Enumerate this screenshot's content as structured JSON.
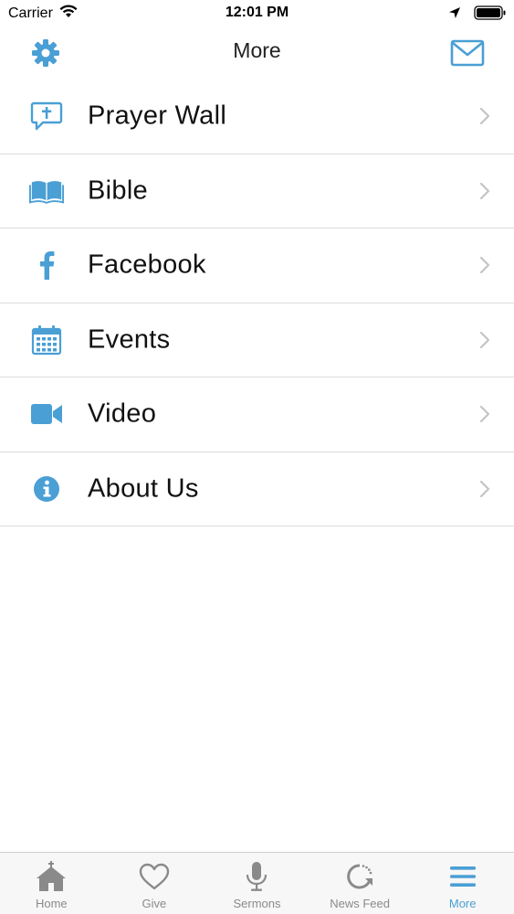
{
  "status_bar": {
    "carrier": "Carrier",
    "time": "12:01 PM"
  },
  "nav": {
    "title": "More",
    "left_icon": "gear-icon",
    "right_icon": "mail-icon"
  },
  "accent_color": "#4a9fd5",
  "menu": {
    "items": [
      {
        "label": "Prayer Wall",
        "icon": "prayer-wall-icon"
      },
      {
        "label": "Bible",
        "icon": "bible-icon"
      },
      {
        "label": "Facebook",
        "icon": "facebook-icon"
      },
      {
        "label": "Events",
        "icon": "calendar-icon"
      },
      {
        "label": "Video",
        "icon": "video-camera-icon"
      },
      {
        "label": "About Us",
        "icon": "info-icon"
      }
    ]
  },
  "tabs": [
    {
      "label": "Home",
      "icon": "church-icon",
      "active": false
    },
    {
      "label": "Give",
      "icon": "heart-icon",
      "active": false
    },
    {
      "label": "Sermons",
      "icon": "microphone-icon",
      "active": false
    },
    {
      "label": "News Feed",
      "icon": "refresh-icon",
      "active": false
    },
    {
      "label": "More",
      "icon": "menu-icon",
      "active": true
    }
  ]
}
